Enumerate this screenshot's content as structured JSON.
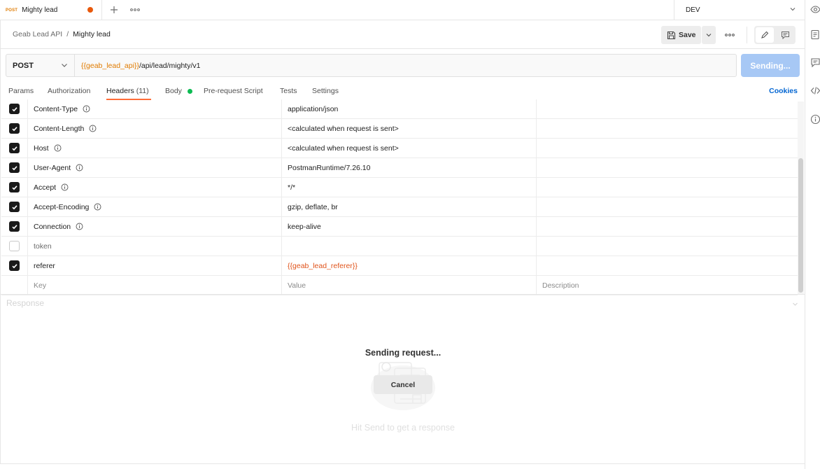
{
  "tab": {
    "method_badge": "POST",
    "title": "Mighty lead"
  },
  "environment": {
    "label": "DEV"
  },
  "breadcrumb": {
    "collection": "Geab Lead API",
    "separator": "/",
    "request": "Mighty lead"
  },
  "toolbar": {
    "save_label": "Save"
  },
  "request": {
    "method": "POST",
    "url_var": "{{geab_lead_api}}",
    "url_path": "/api/lead/mighty/v1",
    "send_label": "Sending..."
  },
  "request_tabs": {
    "params": "Params",
    "authorization": "Authorization",
    "headers": "Headers",
    "headers_count": "(11)",
    "body": "Body",
    "pre_request": "Pre-request Script",
    "tests": "Tests",
    "settings": "Settings",
    "cookies": "Cookies"
  },
  "headers": [
    {
      "key": "Content-Type",
      "value": "application/json",
      "checked": true,
      "info": true
    },
    {
      "key": "Content-Length",
      "value": "<calculated when request is sent>",
      "checked": true,
      "info": true
    },
    {
      "key": "Host",
      "value": "<calculated when request is sent>",
      "checked": true,
      "info": true
    },
    {
      "key": "User-Agent",
      "value": "PostmanRuntime/7.26.10",
      "checked": true,
      "info": true
    },
    {
      "key": "Accept",
      "value": "*/*",
      "checked": true,
      "info": true
    },
    {
      "key": "Accept-Encoding",
      "value": "gzip, deflate, br",
      "checked": true,
      "info": true
    },
    {
      "key": "Connection",
      "value": "keep-alive",
      "checked": true,
      "info": true
    },
    {
      "key": "token",
      "value": "",
      "checked": false,
      "info": false
    },
    {
      "key": "referer",
      "value": "{{geab_lead_referer}}",
      "checked": true,
      "info": false
    }
  ],
  "new_row": {
    "key_placeholder": "Key",
    "value_placeholder": "Value",
    "description_placeholder": "Description"
  },
  "response": {
    "label": "Response",
    "sending_title": "Sending request...",
    "cancel_label": "Cancel",
    "hint": "Hit Send to get a response"
  },
  "colors": {
    "accent": "#ff6c37",
    "send_button": "#a7c8f5",
    "variable": "#e07b00",
    "body_dot": "#0cbb52",
    "link": "#0265d2"
  }
}
